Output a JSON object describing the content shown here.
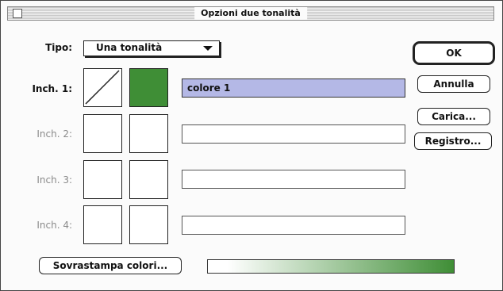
{
  "window": {
    "title": "Opzioni due tonalità"
  },
  "tipo": {
    "label": "Tipo:",
    "value": "Una tonalità"
  },
  "inks": [
    {
      "label": "Inch. 1:",
      "name": "colore 1",
      "color": "#3f8e36"
    },
    {
      "label": "Inch. 2:",
      "name": ""
    },
    {
      "label": "Inch. 3:",
      "name": ""
    },
    {
      "label": "Inch. 4:",
      "name": ""
    }
  ],
  "buttons": {
    "ok": "OK",
    "cancel": "Annulla",
    "load": "Carica...",
    "save": "Registro...",
    "overprint": "Sovrastampa colori..."
  },
  "colors": {
    "ink_green": "#3f8e36",
    "field_highlight": "#b4b8e6",
    "gradient_start": "#ffffff",
    "gradient_end": "#3f8e36"
  }
}
